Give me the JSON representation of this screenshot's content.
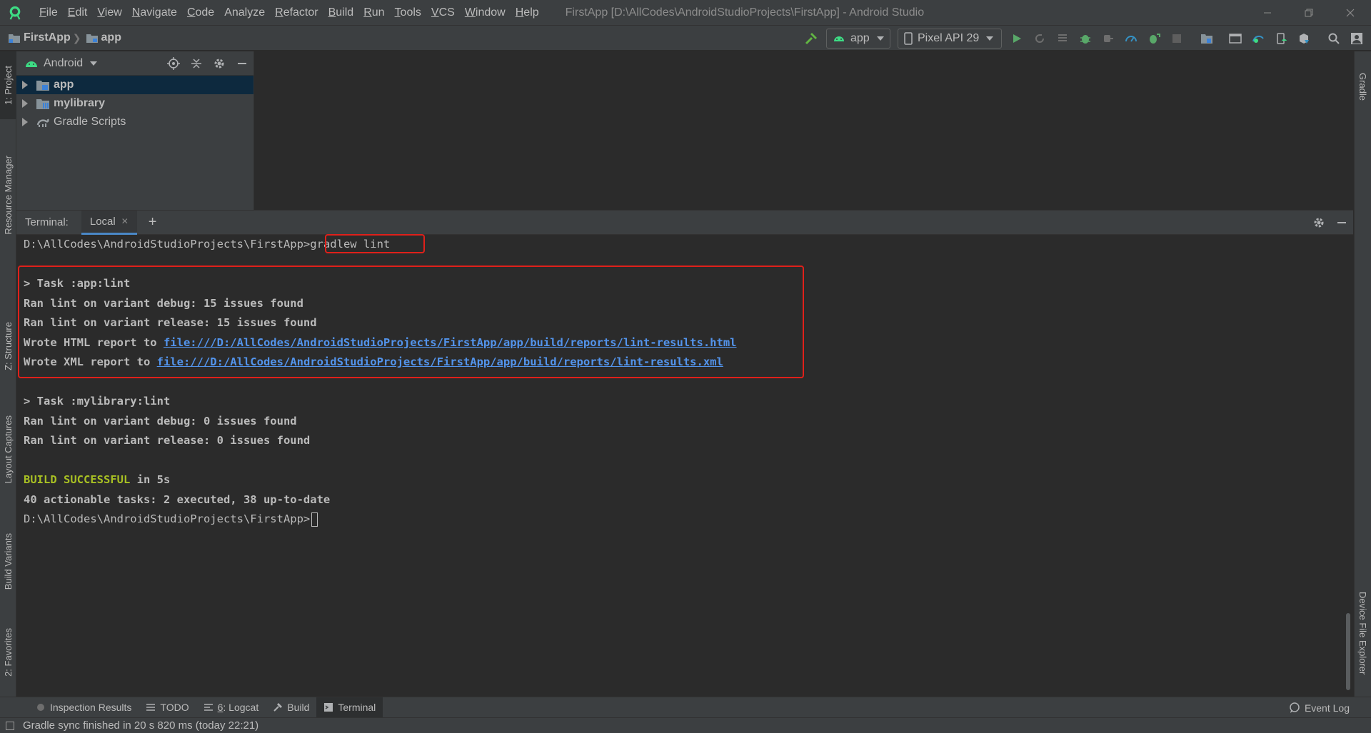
{
  "titlebar": {
    "menu": [
      {
        "label": "File",
        "u": "F",
        "rest": "ile"
      },
      {
        "label": "Edit",
        "u": "E",
        "rest": "dit"
      },
      {
        "label": "View",
        "u": "V",
        "rest": "iew"
      },
      {
        "label": "Navigate",
        "u": "N",
        "rest": "avigate"
      },
      {
        "label": "Code",
        "u": "C",
        "rest": "ode"
      },
      {
        "label": "Analyze",
        "u": "",
        "rest": "Analyze"
      },
      {
        "label": "Refactor",
        "u": "R",
        "rest": "efactor"
      },
      {
        "label": "Build",
        "u": "B",
        "rest": "uild"
      },
      {
        "label": "Run",
        "u": "R",
        "rest": "un"
      },
      {
        "label": "Tools",
        "u": "T",
        "rest": "ools"
      },
      {
        "label": "VCS",
        "u": "V",
        "rest": "CS"
      },
      {
        "label": "Window",
        "u": "W",
        "rest": "indow"
      },
      {
        "label": "Help",
        "u": "H",
        "rest": "elp"
      }
    ],
    "window_title": "FirstApp [D:\\AllCodes\\AndroidStudioProjects\\FirstApp] - Android Studio",
    "controls": [
      "minimize-icon",
      "restore-icon",
      "close-icon"
    ]
  },
  "navbar": {
    "project": "FirstApp",
    "module": "app",
    "run_config": "app",
    "device": "Pixel API 29"
  },
  "left_tabs": {
    "project": "1: Project",
    "resource_manager": "Resource Manager",
    "structure": "Z: Structure",
    "layout_captures": "Layout Captures",
    "build_variants": "Build Variants",
    "favorites": "2: Favorites"
  },
  "right_tabs": {
    "gradle": "Gradle",
    "device_file_explorer": "Device File Explorer"
  },
  "project_panel": {
    "view": "Android",
    "tree": [
      {
        "label": "app",
        "bold": true
      },
      {
        "label": "mylibrary",
        "bold": true
      },
      {
        "label": "Gradle Scripts",
        "bold": false
      }
    ]
  },
  "terminal": {
    "label": "Terminal:",
    "tab": "Local",
    "prompt_path": "D:\\AllCodes\\AndroidStudioProjects\\FirstApp>",
    "command": "gradlew lint",
    "lines": {
      "task_app": "> Task :app:lint",
      "app_debug": "Ran lint on variant debug: 15 issues found",
      "app_release": "Ran lint on variant release: 15 issues found",
      "html_prefix": "Wrote HTML report to ",
      "html_link": "file:///D:/AllCodes/AndroidStudioProjects/FirstApp/app/build/reports/lint-results.html",
      "xml_prefix": "Wrote XML report to ",
      "xml_link": "file:///D:/AllCodes/AndroidStudioProjects/FirstApp/app/build/reports/lint-results.xml",
      "task_lib": "> Task :mylibrary:lint",
      "lib_debug": "Ran lint on variant debug: 0 issues found",
      "lib_release": "Ran lint on variant release: 0 issues found",
      "build_ok": "BUILD SUCCESSFUL",
      "build_time": " in 5s",
      "tasks": "40 actionable tasks: 2 executed, 38 up-to-date",
      "prompt_end": "D:\\AllCodes\\AndroidStudioProjects\\FirstApp>"
    }
  },
  "bottom_tabs": {
    "inspection": "Inspection Results",
    "todo": "TODO",
    "logcat_u": "6",
    "logcat_rest": ": Logcat",
    "build": "Build",
    "terminal": "Terminal",
    "event_log": "Event Log"
  },
  "status": {
    "message": "Gradle sync finished in 20 s 820 ms (today 22:21)"
  },
  "colors": {
    "accent_green": "#a8c023",
    "link": "#5394ec",
    "highlight_red": "#e0201a",
    "selection": "#0d293e"
  }
}
